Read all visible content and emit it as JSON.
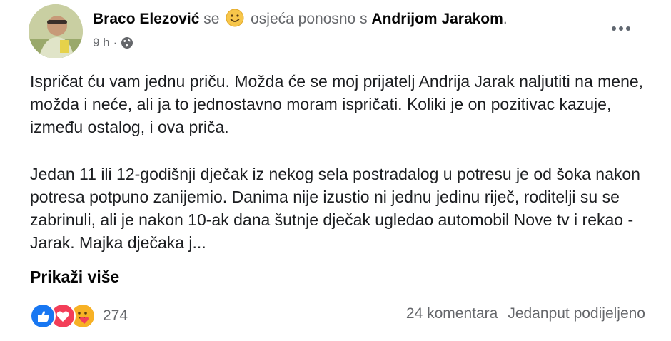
{
  "post": {
    "author": "Braco Elezović",
    "se": "se",
    "feeling": "osjeća ponosno s",
    "tagged": "Andrijom Jarakom",
    "period": ".",
    "time": "9 h",
    "dot": "·",
    "paragraph1": "Ispričat ću vam jednu priču. Možda će se moj prijatelj Andrija Jarak naljutiti na mene, možda i neće, ali ja to jednostavno moram ispričati. Koliki je on pozitivac kazuje, između ostalog, i ova priča.",
    "paragraph2": "Jedan 11 ili 12-godišnji dječak iz nekog sela postradalog u potresu je od šoka nakon potresa potpuno zanijemio. Danima nije izustio ni jednu jedinu riječ, roditelji su se zabrinuli, ali je nakon 10-ak dana šutnje dječak ugledao automobil Nove tv i rekao - Jarak. Majka dječaka j...",
    "see_more": "Prikaži više"
  },
  "footer": {
    "reaction_count": "274",
    "comments": "24 komentara",
    "shares": "Jedanput podijeljeno"
  },
  "icons": {
    "feeling": "smiling-face-icon",
    "privacy": "globe-icon",
    "reactions": [
      "like-icon",
      "love-icon",
      "care-icon"
    ]
  },
  "colors": {
    "like": "#1877f2",
    "love": "#f33e58",
    "care": "#f7b125",
    "muted_text": "#65676b"
  }
}
